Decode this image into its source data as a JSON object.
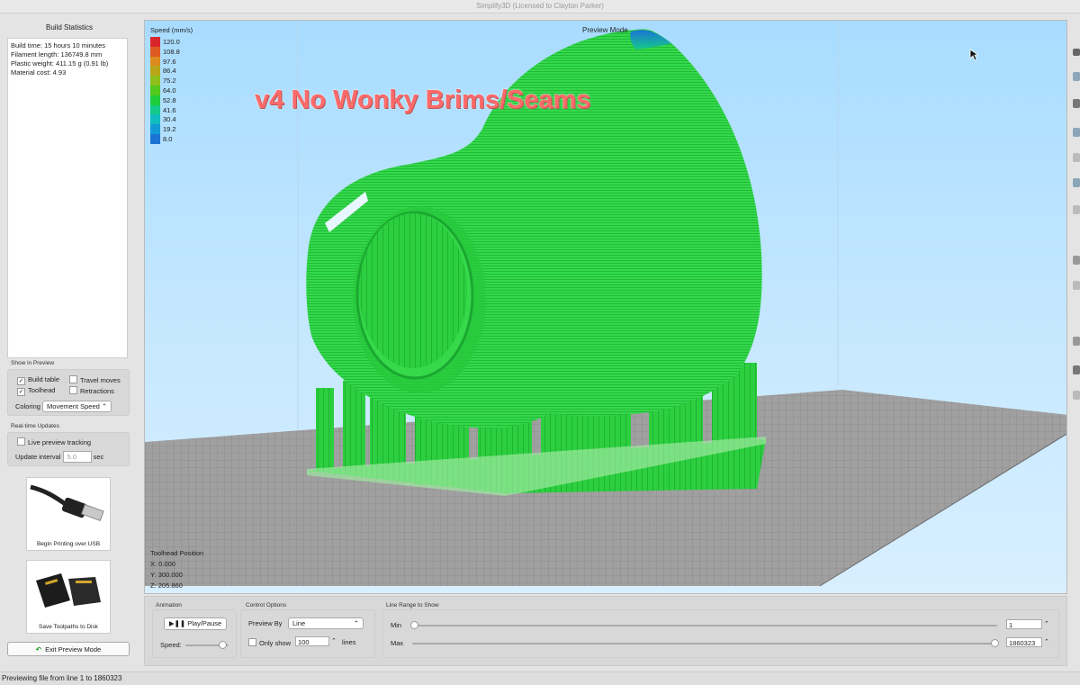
{
  "window": {
    "title": "Simplify3D (Licensed to Clayton Parker)"
  },
  "build_stats": {
    "header": "Build Statistics",
    "lines": [
      "Build time: 15 hours 10 minutes",
      "Filament length: 136749.8 mm",
      "Plastic weight: 411.15 g (0.91 lb)",
      "Material cost: 4.93"
    ]
  },
  "show_in_preview": {
    "title": "Show in Preview",
    "build_table": "Build table",
    "travel_moves": "Travel moves",
    "toolhead": "Toolhead",
    "retractions": "Retractions",
    "coloring_label": "Coloring",
    "coloring_value": "Movement Speed"
  },
  "realtime": {
    "title": "Real-time Updates",
    "live_tracking": "Live preview tracking",
    "interval_label": "Update interval",
    "interval_value": "5.0",
    "interval_unit": "sec"
  },
  "buttons": {
    "usb": "Begin Printing over USB",
    "disk": "Save Toolpaths to Disk",
    "exit": "Exit Preview Mode"
  },
  "viewport": {
    "legend_title": "Speed (mm/s)",
    "legend": [
      {
        "label": "120.0",
        "color": "#d9262b"
      },
      {
        "label": "108.8",
        "color": "#dc5a22"
      },
      {
        "label": "97.6",
        "color": "#dd8a1e"
      },
      {
        "label": "86.4",
        "color": "#b8a61a"
      },
      {
        "label": "75.2",
        "color": "#8fbf1a"
      },
      {
        "label": "64.0",
        "color": "#52c81e"
      },
      {
        "label": "52.8",
        "color": "#1fcd3d"
      },
      {
        "label": "41.6",
        "color": "#14c98a"
      },
      {
        "label": "30.4",
        "color": "#10bcbe"
      },
      {
        "label": "19.2",
        "color": "#1399d5"
      },
      {
        "label": "8.0",
        "color": "#1b74d4"
      }
    ],
    "overlay_title": "v4 No Wonky Brims/Seams",
    "mode_label": "Preview Mode",
    "toolhead_title": "Toolhead Position",
    "toolhead_x": "X: 0.000",
    "toolhead_y": "Y: 300.000",
    "toolhead_z": "Z: 205.860"
  },
  "animation": {
    "title": "Animation",
    "play_pause": "Play/Pause",
    "speed_label": "Speed:",
    "speed_level": 0.85
  },
  "control_options": {
    "title": "Control Options",
    "preview_by_label": "Preview By",
    "preview_by_value": "Line",
    "only_show_label": "Only show",
    "only_show_value": "100",
    "only_show_unit": "lines"
  },
  "line_range": {
    "title": "Line Range to Show",
    "min_label": "Min",
    "min_value": "1",
    "max_label": "Max",
    "max_value": "1860323"
  },
  "status": "Previewing file from line 1 to 1860323"
}
